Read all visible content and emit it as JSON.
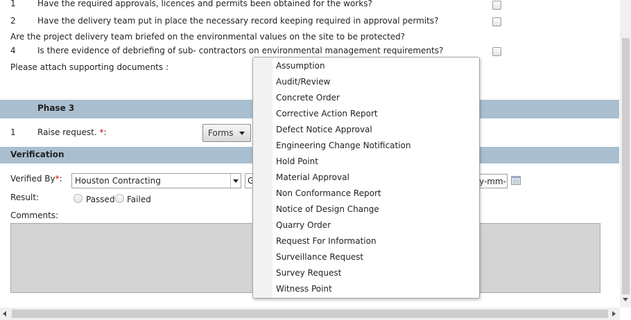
{
  "checklist": [
    {
      "num": "1",
      "question": "Have the required approvals, licences and permits been obtained for the works?"
    },
    {
      "num": "2",
      "question": "Have the delivery team put in place the necessary record keeping required in approval permits?"
    },
    {
      "num": "",
      "question": "Are the project delivery team briefed on the environmental values on the site to be protected?"
    },
    {
      "num": "4",
      "question": "Is there evidence of debriefing of sub- contractors on environmental management requirements?"
    }
  ],
  "attach_label": "Please attach supporting documents :",
  "phase": {
    "title": "Phase 3",
    "num": "1",
    "raise_label": "Raise request.",
    "required_mark": "*",
    "raise_suffix": ":",
    "forms_button": "Forms"
  },
  "verification": {
    "title": "Verification",
    "verified_by_label": "Verified By",
    "required_mark": "*",
    "label_suffix": ":",
    "verified_by_value": "Houston Contracting",
    "second_select_partial": "G",
    "date_partial": "y-mm-",
    "result_label": "Result:",
    "passed": "Passed",
    "failed": "Failed",
    "comments_label": "Comments:"
  },
  "dropdown": {
    "options": [
      "Assumption",
      "Audit/Review",
      "Concrete Order",
      "Corrective Action Report",
      "Defect Notice Approval",
      "Engineering Change Notification",
      "Hold Point",
      "Material Approval",
      "Non Conformance Report",
      "Notice of Design Change",
      "Quarry Order",
      "Request For Information",
      "Surveillance Request",
      "Survey Request",
      "Witness Point"
    ]
  },
  "colors": {
    "band": "#a9bfcf",
    "required": "#d40000",
    "textarea": "#d4d4d4"
  }
}
